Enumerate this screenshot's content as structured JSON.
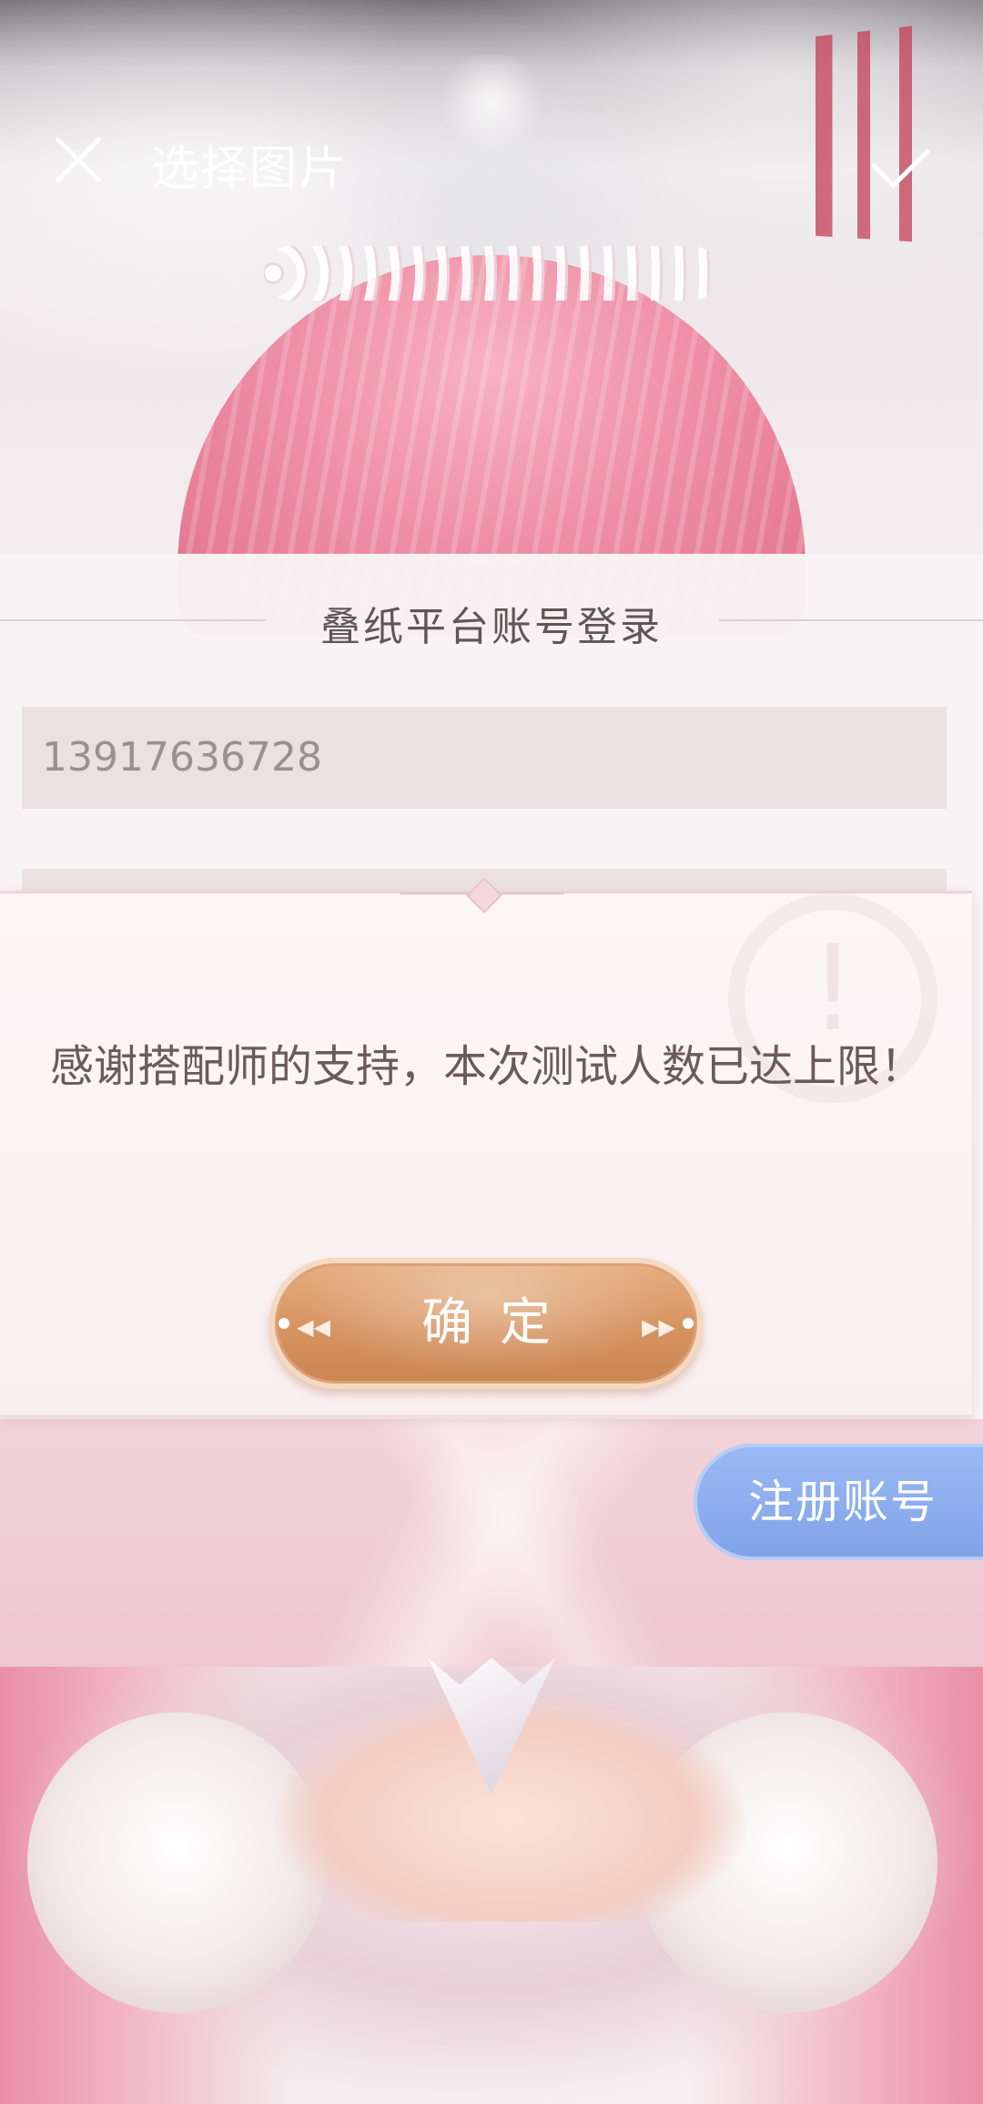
{
  "topbar": {
    "title": "选择图片",
    "close_icon": "close-icon",
    "confirm_icon": "checkmark-icon",
    "text_color": "#ffffff"
  },
  "login": {
    "title": "叠纸平台账号登录",
    "phone_value": "13917636728"
  },
  "dialog": {
    "message": "感谢搭配师的支持，本次测试人数已达上限！",
    "ok_label": "确定",
    "accent": "#d69360"
  },
  "register": {
    "label": "注册账号",
    "color": "#8aaaf0"
  }
}
